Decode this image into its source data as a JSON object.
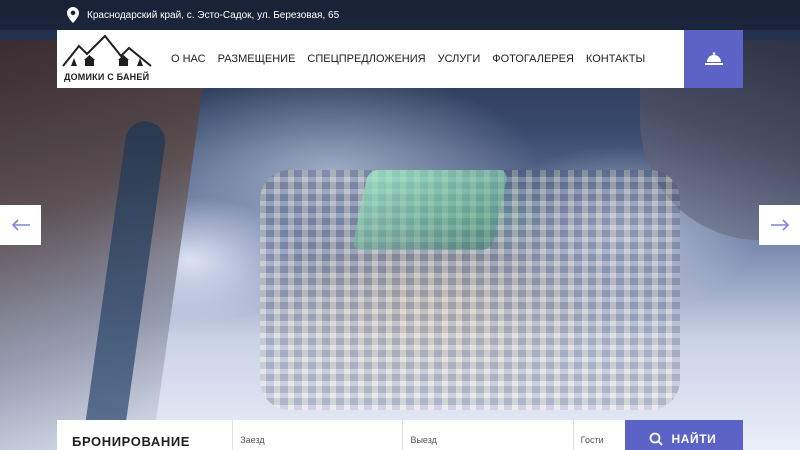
{
  "topbar": {
    "address": "Краснодарский край, с. Эсто-Садок, ул. Березовая, 65"
  },
  "logo": {
    "text": "ДОМИКИ С БАНЕЙ"
  },
  "nav": {
    "items": [
      {
        "label": "О НАС"
      },
      {
        "label": "РАЗМЕЩЕНИЕ"
      },
      {
        "label": "СПЕЦПРЕДЛОЖЕНИЯ"
      },
      {
        "label": "УСЛУГИ"
      },
      {
        "label": "ФОТОГАЛЕРЕЯ"
      },
      {
        "label": "КОНТАКТЫ"
      }
    ]
  },
  "header": {
    "action_icon": "service-bell-icon"
  },
  "slider": {
    "prev_icon": "arrow-left-icon",
    "next_icon": "arrow-right-icon"
  },
  "booking": {
    "title": "БРОНИРОВАНИЕ",
    "checkin_label": "Заезд",
    "checkout_label": "Выезд",
    "guests_label": "Гости",
    "find_label": "НАЙТИ",
    "find_icon": "search-icon"
  },
  "colors": {
    "accent": "#5b63c6",
    "header_bg": "#ffffff",
    "text": "#1f1f1f"
  }
}
